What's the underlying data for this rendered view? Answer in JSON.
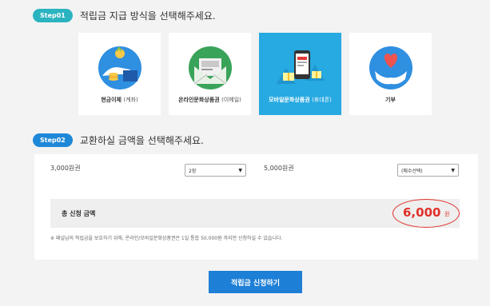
{
  "step1": {
    "badge": "Step01",
    "title": "적립금 지급 방식을 선택해주세요.",
    "options": [
      {
        "label": "현금이체",
        "sub": "(계좌)",
        "icon": "cash-transfer-icon",
        "selected": false
      },
      {
        "label": "온라인문화상품권",
        "sub": "(이메일)",
        "icon": "envelope-giftcard-icon",
        "selected": false
      },
      {
        "label": "모바일문화상품권",
        "sub": "(휴대폰)",
        "icon": "mobile-giftcard-icon",
        "selected": true
      },
      {
        "label": "기부",
        "sub": "",
        "icon": "donation-heart-icon",
        "selected": false
      }
    ]
  },
  "step2": {
    "badge": "Step02",
    "title": "교환하실 금액을 선택해주세요.",
    "items": [
      {
        "label": "3,000원권",
        "select_value": "2장"
      },
      {
        "label": "5,000원권",
        "select_value": "(매수선택)"
      }
    ],
    "total_label": "총 신청 금액",
    "total_amount": "6,000",
    "total_unit": "원",
    "note": "※ 패널님의 적립금을 보호하기 위해, 온라인/모바일문화상품권은 1일 통합 50,000원 까지만 신청하실 수 있습니다."
  },
  "apply_button": "적립금 신청하기",
  "colors": {
    "step1_badge": "#2bb3c0",
    "step2_badge": "#1e88d8",
    "selected_tile": "#27a9e1",
    "total_red": "#e0312a",
    "button": "#1e7fd6"
  }
}
